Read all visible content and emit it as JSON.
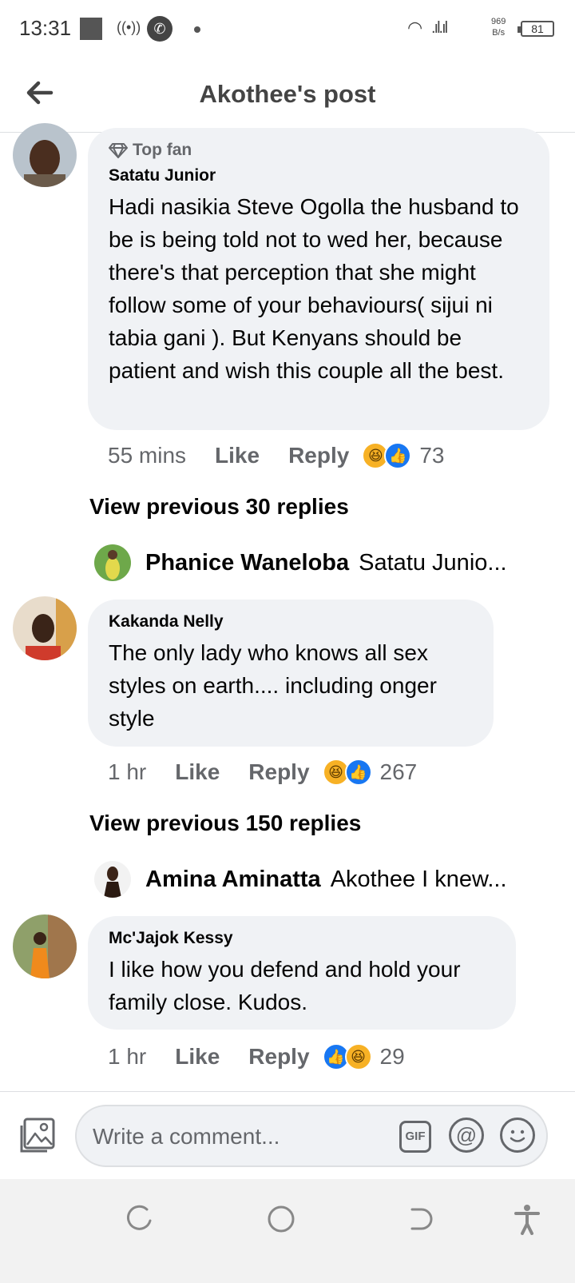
{
  "status_bar": {
    "time": "13:31",
    "net_speed_value": "969",
    "net_speed_unit": "B/s",
    "battery": "81"
  },
  "header": {
    "title": "Akothee's post",
    "back_icon": "arrow-left-icon"
  },
  "comments": [
    {
      "badge": "Top fan",
      "badge_icon": "diamond-icon",
      "author": "Satatu Junior",
      "text": "Hadi nasikia Steve Ogolla the husband to be is being told not to wed her, because there's that perception that she might follow some of your behaviours( sijui ni tabia gani ). But Kenyans should be patient and wish this couple all the best.",
      "time": "55 mins",
      "like_label": "Like",
      "reply_label": "Reply",
      "reactions": [
        "haha",
        "like"
      ],
      "reaction_count": "73",
      "view_previous": "View previous 30 replies",
      "latest_reply": {
        "name": "Phanice Waneloba",
        "snippet": "Satatu Junio..."
      }
    },
    {
      "author": "Kakanda Nelly",
      "text": "The only lady who knows all sex styles on earth.... including onger style",
      "time": "1 hr",
      "like_label": "Like",
      "reply_label": "Reply",
      "reactions": [
        "haha",
        "like"
      ],
      "reaction_count": "267",
      "view_previous": "View previous 150 replies",
      "latest_reply": {
        "name": "Amina Aminatta",
        "snippet": "Akothee I knew..."
      }
    },
    {
      "author": "Mc'Jajok Kessy",
      "text": "I like how you defend and hold your family close. Kudos.",
      "time": "1 hr",
      "like_label": "Like",
      "reply_label": "Reply",
      "reactions": [
        "like",
        "haha"
      ],
      "reaction_count": "29"
    }
  ],
  "composer": {
    "placeholder": "Write a comment...",
    "gif_label": "GIF",
    "at_label": "@"
  },
  "colors": {
    "bubble": "#f0f2f5",
    "secondary_text": "#65676b",
    "like_blue": "#1877f2",
    "haha_yellow": "#f7b125"
  }
}
